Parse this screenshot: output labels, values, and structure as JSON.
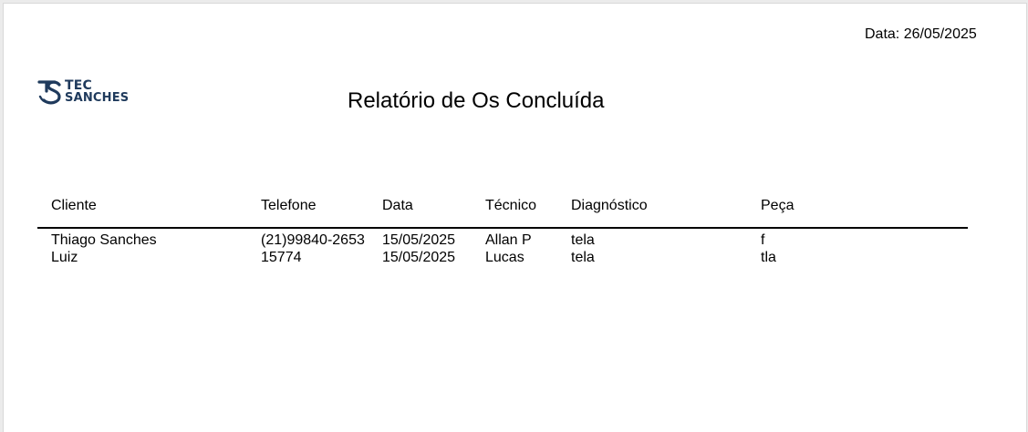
{
  "report": {
    "date_label": "Data: 26/05/2025",
    "title": "Relatório de Os Concluída"
  },
  "logo": {
    "line1": "TEC",
    "line2": "SANCHES",
    "color": "#1f3a5c",
    "icon": "ts-monogram-icon"
  },
  "table": {
    "columns": [
      "Cliente",
      "Telefone",
      "Data",
      "Técnico",
      "Diagnóstico",
      "Peça"
    ],
    "rows": [
      [
        "Thiago Sanches",
        "(21)99840-2653",
        "15/05/2025",
        "Allan P",
        "tela",
        "f"
      ],
      [
        "Luiz",
        "15774",
        "15/05/2025",
        "Lucas",
        "tela",
        "tla"
      ]
    ]
  }
}
